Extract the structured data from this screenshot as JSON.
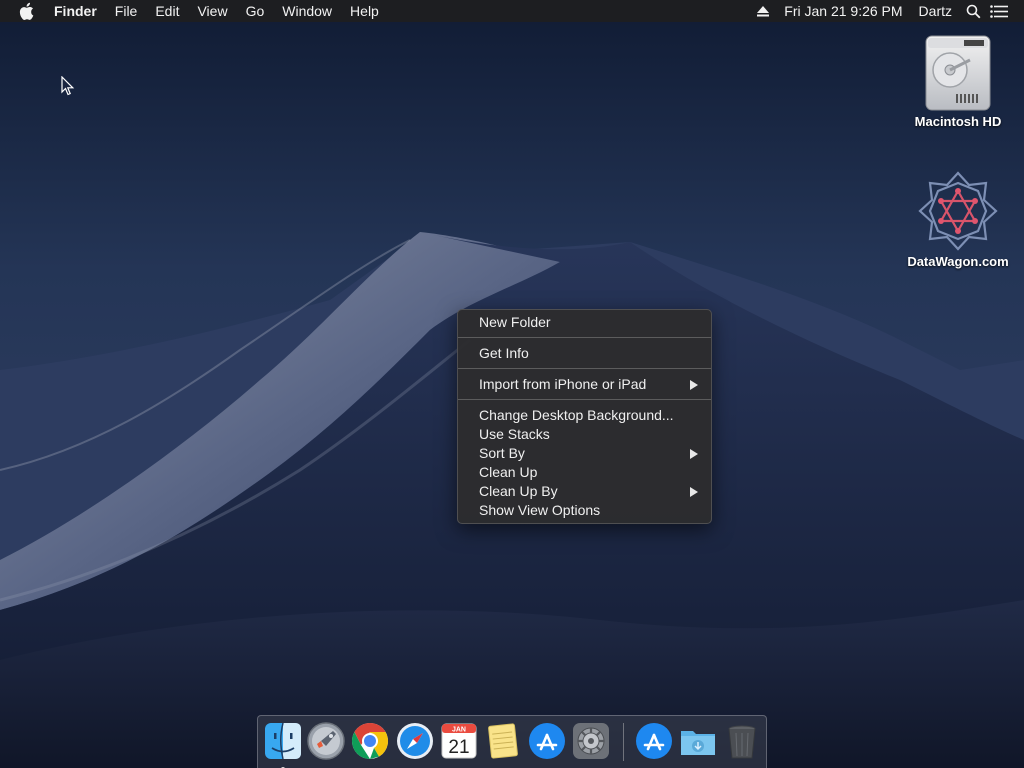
{
  "menubar": {
    "app_name": "Finder",
    "menus": [
      "File",
      "Edit",
      "View",
      "Go",
      "Window",
      "Help"
    ],
    "clock": "Fri Jan 21  9:26 PM",
    "user": "Dartz"
  },
  "desktop": {
    "icons": [
      {
        "label": "Macintosh HD",
        "icon": "hard-drive-icon"
      },
      {
        "label": "DataWagon.com",
        "icon": "datawagon-logo-icon"
      }
    ]
  },
  "context_menu": {
    "new_folder": "New Folder",
    "get_info": "Get Info",
    "import_iphone": "Import from iPhone or iPad",
    "change_background": "Change Desktop Background...",
    "use_stacks": "Use Stacks",
    "sort_by": "Sort By",
    "clean_up": "Clean Up",
    "clean_up_by": "Clean Up By",
    "show_view_options": "Show View Options"
  },
  "dock": {
    "items": [
      "Finder",
      "Launchpad",
      "Chrome",
      "Safari",
      "Calendar",
      "Notes",
      "App Store",
      "System Preferences",
      "App Store",
      "Downloads",
      "Trash"
    ],
    "calendar_month": "JAN",
    "calendar_day": "21"
  },
  "colors": {
    "menu_bg": "#1e1e20",
    "context_menu_bg": "#2c2c2e",
    "wallpaper_sky": "#1a2540"
  }
}
